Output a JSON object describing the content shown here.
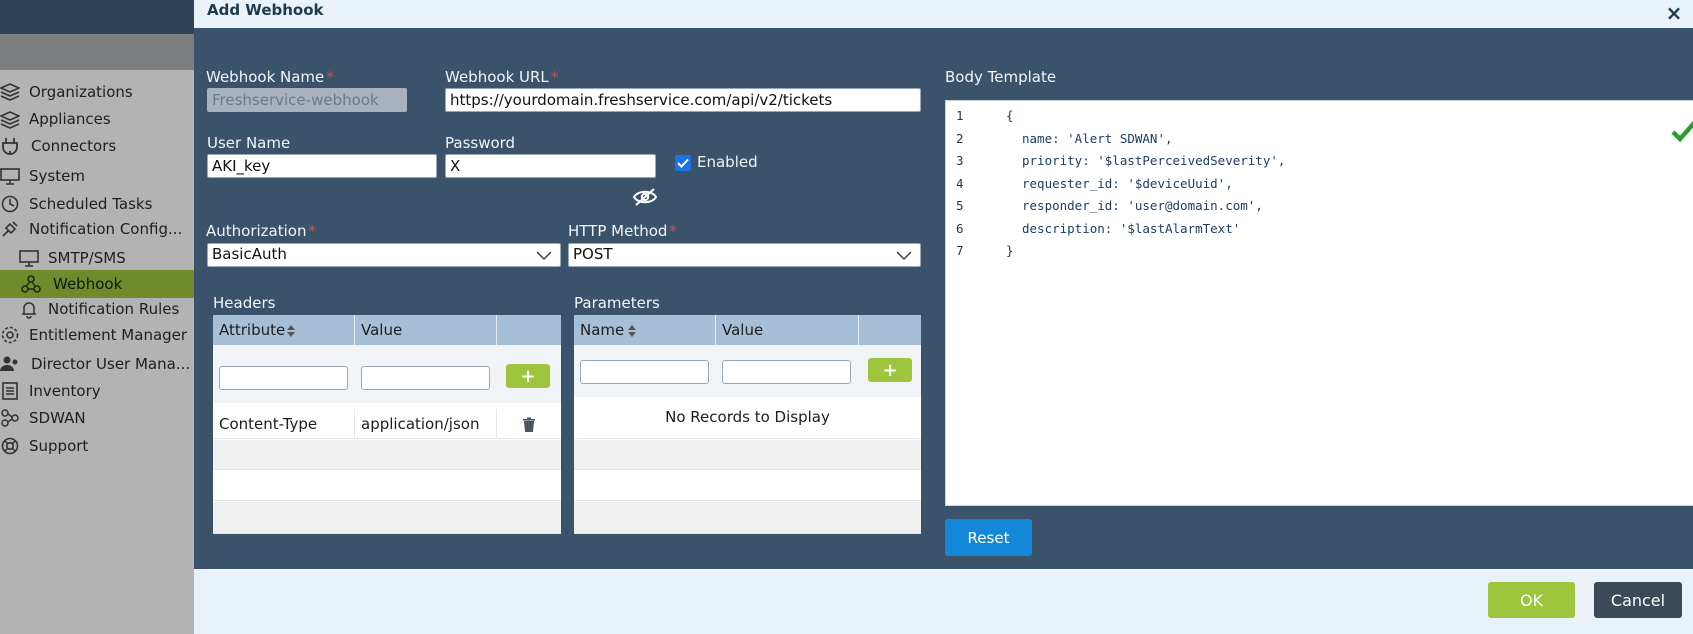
{
  "sidebar": {
    "items": [
      {
        "label": "Organizations",
        "icon": "organizations-icon"
      },
      {
        "label": "Appliances",
        "icon": "appliances-icon"
      },
      {
        "label": "Connectors",
        "icon": "connectors-icon"
      },
      {
        "label": "System",
        "icon": "system-icon"
      },
      {
        "label": "Scheduled Tasks",
        "icon": "scheduled-tasks-icon"
      },
      {
        "label": "Notification Config...",
        "icon": "notification-config-icon"
      },
      {
        "label": "SMTP/SMS",
        "icon": "smtp-sms-icon"
      },
      {
        "label": "Webhook",
        "icon": "webhook-icon",
        "active": true
      },
      {
        "label": "Notification Rules",
        "icon": "notification-rules-icon"
      },
      {
        "label": "Entitlement Manager",
        "icon": "entitlement-manager-icon"
      },
      {
        "label": "Director User Mana...",
        "icon": "director-user-icon"
      },
      {
        "label": "Inventory",
        "icon": "inventory-icon"
      },
      {
        "label": "SDWAN",
        "icon": "sdwan-icon"
      },
      {
        "label": "Support",
        "icon": "support-icon"
      }
    ]
  },
  "modal": {
    "title": "Add Webhook",
    "close": "×",
    "webhook_name_label": "Webhook Name",
    "webhook_name_value": "Freshservice-webhook",
    "webhook_url_label": "Webhook URL",
    "webhook_url_value": "https://yourdomain.freshservice.com/api/v2/tickets",
    "username_label": "User Name",
    "username_value": "AKI_key",
    "password_label": "Password",
    "password_value": "X",
    "enabled_label": "Enabled",
    "enabled_checked": true,
    "authorization_label": "Authorization",
    "authorization_value": "BasicAuth",
    "http_method_label": "HTTP Method",
    "http_method_value": "POST",
    "required_mark": "*",
    "headers": {
      "title": "Headers",
      "columns": [
        "Attribute",
        "Value"
      ],
      "rows": [
        {
          "attribute": "Content-Type",
          "value": "application/json"
        }
      ]
    },
    "parameters": {
      "title": "Parameters",
      "columns": [
        "Name",
        "Value"
      ],
      "empty_text": "No Records to Display"
    },
    "add_symbol": "+",
    "body_template_label": "Body Template",
    "body_template_lines": [
      {
        "num": "1",
        "text": "{"
      },
      {
        "num": "2",
        "text": "name: 'Alert SDWAN',"
      },
      {
        "num": "3",
        "text": "priority: '$lastPerceivedSeverity',"
      },
      {
        "num": "4",
        "text": "requester_id: '$deviceUuid',"
      },
      {
        "num": "5",
        "text": "responder_id: 'user@domain.com',"
      },
      {
        "num": "6",
        "text": "description: '$lastAlarmText'"
      },
      {
        "num": "7",
        "text": "}"
      }
    ],
    "reset_label": "Reset",
    "ok_label": "OK",
    "cancel_label": "Cancel"
  },
  "colors": {
    "modal_bg": "#3a526a",
    "accent_green": "#9dc53e",
    "accent_blue": "#1488d8",
    "sidebar_active": "#6f8b2b"
  }
}
